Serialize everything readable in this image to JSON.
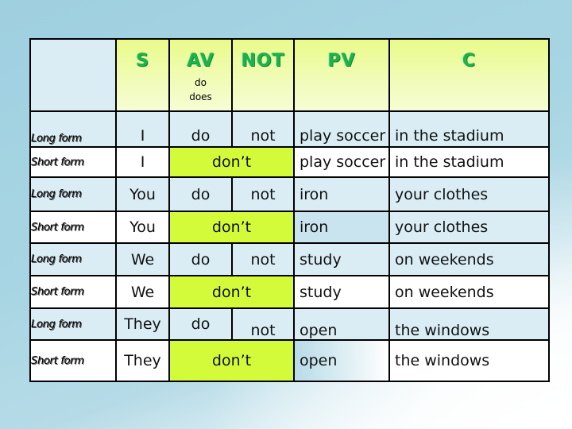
{
  "header": {
    "columns": [
      {
        "key": "label",
        "title": ""
      },
      {
        "key": "s",
        "title": "S"
      },
      {
        "key": "av",
        "title": "AV",
        "sub": [
          "do",
          "does"
        ]
      },
      {
        "key": "not",
        "title": "NOT"
      },
      {
        "key": "pv",
        "title": "PV"
      },
      {
        "key": "c",
        "title": "C"
      }
    ]
  },
  "rows": [
    {
      "form": "Long form",
      "s": "I",
      "av": "do",
      "not": "not",
      "pv": "play soccer",
      "c": "in the stadium"
    },
    {
      "form": "Short form",
      "s": "I",
      "contraction": "don’t",
      "pv": "play soccer",
      "c": "in the stadium"
    },
    {
      "form": "Long form",
      "s": "You",
      "av": "do",
      "not": "not",
      "pv": "iron",
      "c": "your clothes"
    },
    {
      "form": "Short form",
      "s": "You",
      "contraction": "don’t",
      "pv": "iron",
      "c": "your clothes"
    },
    {
      "form": "Long form",
      "s": "We",
      "av": "do",
      "not": "not",
      "pv": "study",
      "c": "on weekends"
    },
    {
      "form": "Short form",
      "s": "We",
      "contraction": "don’t",
      "pv": "study",
      "c": "on weekends"
    },
    {
      "form": "Long form",
      "s": "They",
      "av": "do",
      "not": "not",
      "pv": "open",
      "c": "the windows"
    },
    {
      "form": "Short form",
      "s": "They",
      "contraction": "don’t",
      "pv": "open",
      "c": "the windows"
    }
  ],
  "colors": {
    "header_title": "#1fb24a",
    "header_bg": "#e9fb8a",
    "long_row_bg": "#daedf4",
    "short_row_bg": "#ffffff",
    "contraction_bg": "#d4fb3a"
  }
}
